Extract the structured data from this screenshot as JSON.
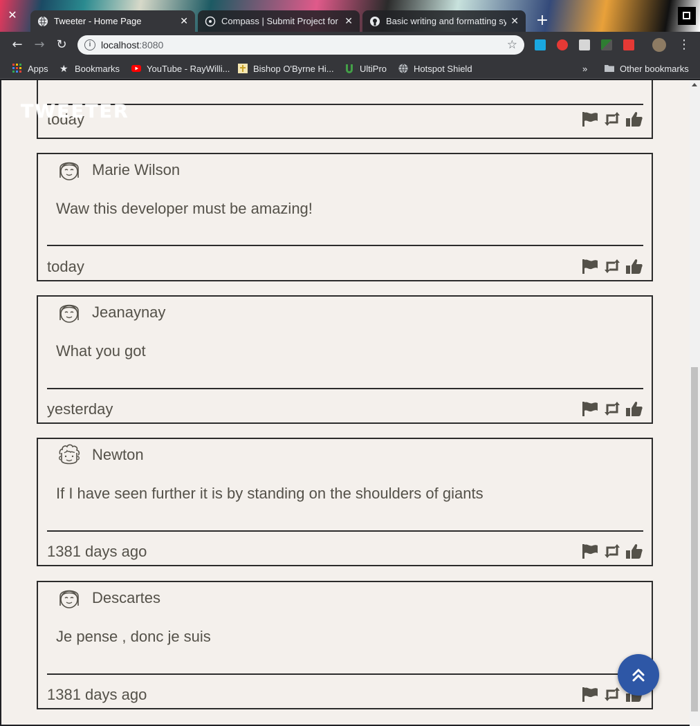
{
  "browser": {
    "tabs": [
      {
        "title": "Tweeter - Home Page",
        "active": true
      },
      {
        "title": "Compass | Submit Project for Review",
        "active": false
      },
      {
        "title": "Basic writing and formatting syntax",
        "active": false
      }
    ],
    "url_host": "localhost",
    "url_port": ":8080",
    "bookmarks": [
      {
        "label": "Apps",
        "icon": "apps-grid-icon"
      },
      {
        "label": "Bookmarks",
        "icon": "star-icon"
      },
      {
        "label": "YouTube - RayWilli...",
        "icon": "youtube-icon"
      },
      {
        "label": "Bishop O'Byrne Hi...",
        "icon": "cross-icon"
      },
      {
        "label": "UltiPro",
        "icon": "ultipro-icon"
      },
      {
        "label": "Hotspot Shield",
        "icon": "globe-icon"
      }
    ],
    "bookmarks_overflow": "»",
    "other_bookmarks": "Other bookmarks"
  },
  "app": {
    "logo": "TWEETER"
  },
  "tweets": [
    {
      "user": "",
      "avatar": "girl-avatar-icon",
      "text": "",
      "time": "today"
    },
    {
      "user": "Marie Wilson",
      "avatar": "girl-avatar-icon",
      "text": "Waw this developer must be amazing!",
      "time": "today"
    },
    {
      "user": "Jeanaynay",
      "avatar": "girl-avatar-icon",
      "text": "What you got",
      "time": "yesterday"
    },
    {
      "user": "Newton",
      "avatar": "curly-hair-avatar-icon",
      "text": "If I have seen further it is by standing on the shoulders of giants",
      "time": "1381 days ago"
    },
    {
      "user": "Descartes",
      "avatar": "girl-avatar-icon",
      "text": "Je pense , donc je suis",
      "time": "1381 days ago"
    }
  ],
  "colors": {
    "page_bg": "#f4f0ec",
    "text": "#545149",
    "border": "#2b2b2b",
    "scroll_button": "#2e57a6"
  }
}
